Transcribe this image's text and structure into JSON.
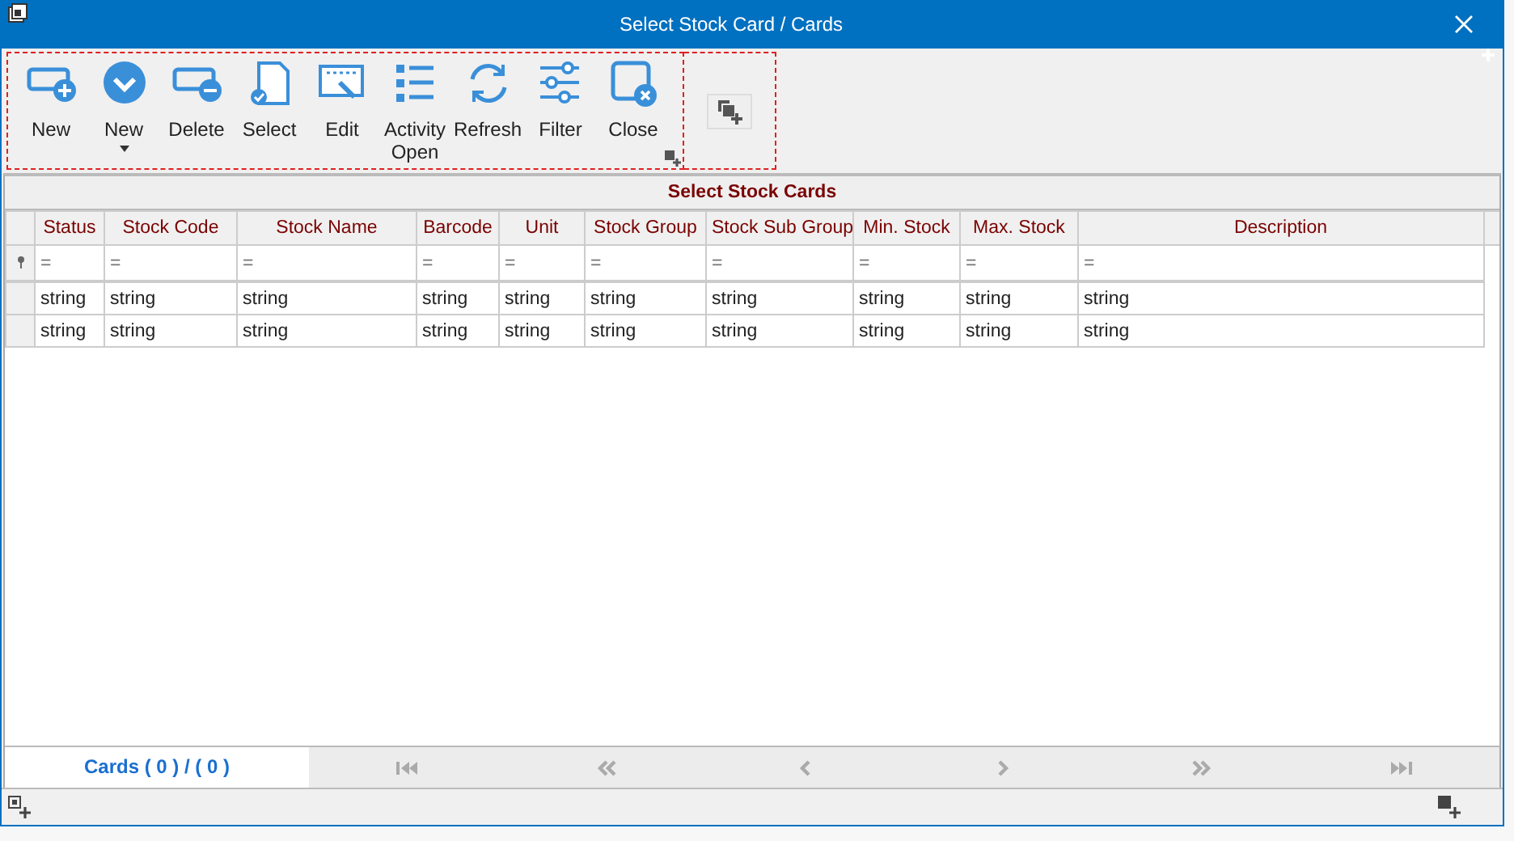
{
  "window": {
    "title": "Select Stock Card / Cards"
  },
  "toolbar": [
    {
      "label": "New",
      "dropdown": false
    },
    {
      "label": "New",
      "dropdown": true
    },
    {
      "label": "Delete",
      "dropdown": false
    },
    {
      "label": "Select",
      "dropdown": false
    },
    {
      "label": "Edit",
      "dropdown": false
    },
    {
      "label": "Activity Open",
      "dropdown": false
    },
    {
      "label": "Refresh",
      "dropdown": false
    },
    {
      "label": "Filter",
      "dropdown": false
    },
    {
      "label": "Close",
      "dropdown": false
    }
  ],
  "grid": {
    "title": "Select Stock Cards",
    "columns": [
      "Status",
      "Stock Code",
      "Stock Name",
      "Barcode",
      "Unit",
      "Stock Group",
      "Stock Sub Group",
      "Min. Stock",
      "Max. Stock",
      "Description"
    ],
    "filter_row": [
      "=",
      "=",
      "=",
      "=",
      "=",
      "=",
      "=",
      "=",
      "=",
      "="
    ],
    "rows": [
      [
        "string",
        "string",
        "string",
        "string",
        "string",
        "string",
        "string",
        "string",
        "string",
        "string"
      ],
      [
        "string",
        "string",
        "string",
        "string",
        "string",
        "string",
        "string",
        "string",
        "string",
        "string"
      ]
    ]
  },
  "footer": {
    "record_count": "Cards ( 0 ) / ( 0 )"
  }
}
